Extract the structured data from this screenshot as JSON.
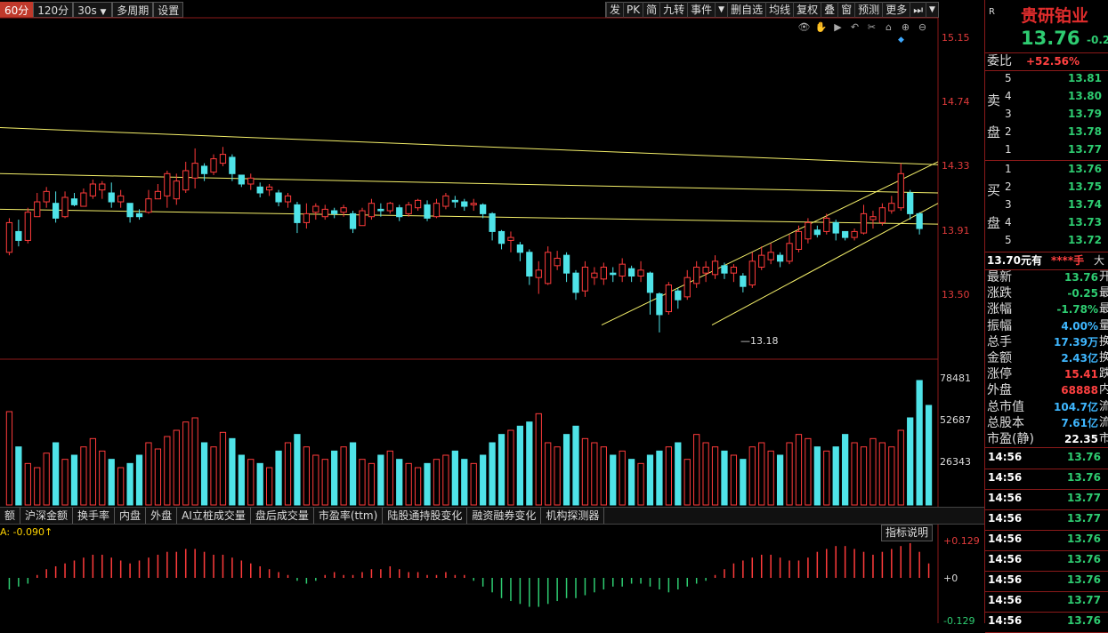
{
  "toolbar": {
    "left": [
      "60分",
      "120分",
      "30s",
      "多周期",
      "设置"
    ],
    "right": [
      "发",
      "PK",
      "简",
      "九转",
      "事件",
      "删自选",
      "均线",
      "复权",
      "叠",
      "窗",
      "预测",
      "更多"
    ]
  },
  "price_axis": [
    "15.15",
    "14.74",
    "14.33",
    "13.91",
    "13.50"
  ],
  "volume_axis": [
    "78481",
    "52687",
    "26343"
  ],
  "macd_axis": {
    "top": "+0.129",
    "mid": "+0",
    "bottom": "-0.129"
  },
  "low_label": "13.18",
  "macd_value": "A: -0.090↑",
  "indicator_tabs": [
    "额",
    "沪深金额",
    "换手率",
    "内盘",
    "外盘",
    "AI立桩成交量",
    "盘后成交量",
    "市盈率(ttm)",
    "陆股通持股变化",
    "融资融券变化",
    "机构探测器"
  ],
  "help_button": "指标说明",
  "quote": {
    "badge": "R",
    "name": "贵研铂业",
    "price": "13.76",
    "change": "-0.2",
    "weibi_label": "委比",
    "weibi_value": "+52.56%",
    "sell_label": [
      "卖",
      "盘"
    ],
    "buy_label": [
      "买",
      "盘"
    ],
    "sell": [
      [
        "5",
        "13.81"
      ],
      [
        "4",
        "13.80"
      ],
      [
        "3",
        "13.79"
      ],
      [
        "2",
        "13.78"
      ],
      [
        "1",
        "13.77"
      ]
    ],
    "buy": [
      [
        "1",
        "13.76"
      ],
      [
        "2",
        "13.75"
      ],
      [
        "3",
        "13.74"
      ],
      [
        "4",
        "13.73"
      ],
      [
        "5",
        "13.72"
      ]
    ],
    "bigorder_price": "13.70元有",
    "bigorder_mask": "****手",
    "bigorder_tail": "大",
    "stats": [
      {
        "label": "最新",
        "value": "13.76",
        "tail": "开",
        "color": "green"
      },
      {
        "label": "涨跌",
        "value": "-0.25",
        "tail": "最",
        "color": "green"
      },
      {
        "label": "涨幅",
        "value": "-1.78%",
        "tail": "最",
        "color": "green"
      },
      {
        "label": "振幅",
        "value": "4.00%",
        "tail": "量",
        "color": "cyan"
      },
      {
        "label": "总手",
        "value": "17.39万",
        "tail": "换",
        "color": "cyan"
      },
      {
        "label": "金额",
        "value": "2.43亿",
        "tail": "换",
        "color": "cyan"
      },
      {
        "label": "涨停",
        "value": "15.41",
        "tail": "跌",
        "color": "red"
      },
      {
        "label": "外盘",
        "value": "68888",
        "tail": "内",
        "color": "red"
      },
      {
        "label": "总市值",
        "value": "104.7亿",
        "tail": "流",
        "color": "cyan"
      },
      {
        "label": "总股本",
        "value": "7.61亿",
        "tail": "流",
        "color": "cyan"
      },
      {
        "label": "市盈(静)",
        "value": "22.35",
        "tail": "市",
        "color": "white"
      }
    ],
    "ticks": [
      {
        "time": "14:56",
        "price": "13.76"
      },
      {
        "time": "14:56",
        "price": "13.76"
      },
      {
        "time": "14:56",
        "price": "13.77"
      },
      {
        "time": "14:56",
        "price": "13.77"
      },
      {
        "time": "14:56",
        "price": "13.76"
      },
      {
        "time": "14:56",
        "price": "13.76"
      },
      {
        "time": "14:56",
        "price": "13.76"
      },
      {
        "time": "14:56",
        "price": "13.77"
      },
      {
        "time": "14:56",
        "price": "13.76"
      }
    ]
  },
  "colors": {
    "up": "#ff3b3b",
    "down": "#4fe3e8",
    "trend": "#f5f06a",
    "frame": "#8b1a1a"
  },
  "chart_data": {
    "type": "candlestick",
    "ylim": [
      13.0,
      15.3
    ],
    "candles": [
      [
        13.72,
        13.92,
        13.86,
        13.95,
        13.7
      ],
      [
        13.86,
        13.8,
        13.94,
        13.76,
        13.89
      ],
      [
        13.8,
        13.99,
        13.95,
        14.02,
        13.78
      ],
      [
        13.96,
        14.06,
        14.09,
        14.12,
        13.96
      ],
      [
        14.06,
        14.13,
        14.04,
        14.16,
        14.02
      ],
      [
        14.05,
        13.95,
        14.13,
        13.92,
        14.13
      ],
      [
        13.96,
        14.09,
        14.06,
        14.13,
        13.95
      ],
      [
        14.08,
        14.04,
        14.12,
        14.03,
        14.08
      ],
      [
        14.03,
        14.12,
        14.1,
        14.15,
        14.03
      ],
      [
        14.1,
        14.18,
        14.14,
        14.21,
        14.08
      ],
      [
        14.14,
        14.18,
        14.1,
        14.2,
        14.08
      ],
      [
        14.12,
        14.06,
        14.19,
        14.02,
        14.14
      ],
      [
        14.06,
        14.1,
        14.05,
        14.14,
        14.02
      ],
      [
        14.05,
        13.96,
        13.98,
        14.02,
        13.92
      ],
      [
        13.98,
        13.96,
        14.01,
        13.94,
        14.0
      ],
      [
        13.99,
        14.08,
        14.07,
        14.14,
        13.98
      ],
      [
        14.08,
        14.13,
        14.1,
        14.18,
        14.08
      ],
      [
        14.1,
        14.25,
        14.06,
        14.27,
        14.02
      ],
      [
        14.08,
        14.2,
        14.14,
        14.25,
        14.04
      ],
      [
        14.14,
        14.27,
        14.2,
        14.33,
        14.12
      ],
      [
        14.22,
        14.32,
        14.3,
        14.42,
        14.15
      ],
      [
        14.3,
        14.25,
        14.32,
        14.2,
        14.27
      ],
      [
        14.26,
        14.35,
        14.32,
        14.38,
        14.24
      ],
      [
        14.32,
        14.38,
        14.36,
        14.43,
        14.3
      ],
      [
        14.36,
        14.25,
        14.38,
        14.2,
        14.24
      ],
      [
        14.24,
        14.18,
        14.21,
        14.16,
        14.18
      ],
      [
        14.18,
        14.22,
        14.16,
        14.25,
        14.14
      ],
      [
        14.16,
        14.12,
        14.19,
        14.09,
        14.14
      ],
      [
        14.14,
        14.16,
        14.13,
        14.18,
        14.1
      ],
      [
        14.12,
        14.06,
        14.14,
        14.03,
        14.06
      ],
      [
        14.06,
        14.1,
        14.04,
        14.12,
        14.02
      ],
      [
        14.04,
        13.92,
        14.06,
        13.85,
        13.92
      ],
      [
        13.92,
        13.98,
        14.0,
        14.05,
        13.88
      ],
      [
        13.99,
        14.03,
        13.96,
        14.05,
        13.94
      ],
      [
        13.96,
        14.01,
        13.99,
        14.04,
        13.94
      ],
      [
        14.0,
        13.98,
        14.02,
        13.95,
        14.0
      ],
      [
        13.99,
        14.02,
        13.98,
        14.04,
        13.96
      ],
      [
        13.98,
        13.88,
        14.0,
        13.85,
        13.88
      ],
      [
        13.9,
        14.0,
        13.96,
        14.02,
        13.9
      ],
      [
        13.96,
        14.05,
        14.0,
        14.08,
        13.94
      ],
      [
        14.01,
        14.0,
        14.05,
        13.96,
        14.0
      ],
      [
        14.0,
        14.05,
        14.02,
        14.06,
        13.98
      ],
      [
        14.02,
        13.96,
        14.04,
        13.93,
        13.99
      ],
      [
        13.98,
        14.04,
        14.01,
        14.06,
        13.96
      ],
      [
        14.02,
        14.07,
        14.04,
        14.08,
        14.0
      ],
      [
        14.04,
        13.95,
        14.07,
        13.93,
        13.96
      ],
      [
        13.96,
        14.05,
        14.02,
        14.08,
        13.95
      ],
      [
        14.03,
        14.1,
        14.07,
        14.12,
        14.01
      ],
      [
        14.07,
        14.06,
        14.1,
        14.02,
        14.06
      ],
      [
        14.06,
        14.03,
        14.08,
        14.0,
        14.04
      ],
      [
        14.04,
        14.05,
        14.03,
        14.08,
        14.0
      ],
      [
        14.04,
        13.98,
        14.05,
        13.95,
        13.98
      ],
      [
        13.98,
        13.86,
        13.99,
        13.8,
        13.86
      ],
      [
        13.86,
        13.78,
        13.87,
        13.74,
        13.8
      ],
      [
        13.8,
        13.82,
        13.76,
        13.86,
        13.72
      ],
      [
        13.77,
        13.72,
        13.79,
        13.66,
        13.72
      ],
      [
        13.72,
        13.56,
        13.74,
        13.5,
        13.56
      ],
      [
        13.55,
        13.6,
        13.5,
        13.66,
        13.44
      ],
      [
        13.51,
        13.72,
        13.62,
        13.76,
        13.5
      ],
      [
        13.63,
        13.68,
        13.7,
        13.73,
        13.6
      ],
      [
        13.7,
        13.58,
        13.72,
        13.52,
        13.6
      ],
      [
        13.58,
        13.45,
        13.6,
        13.4,
        13.46
      ],
      [
        13.46,
        13.62,
        13.55,
        13.66,
        13.42
      ],
      [
        13.55,
        13.58,
        13.54,
        13.62,
        13.5
      ],
      [
        13.54,
        13.62,
        13.58,
        13.65,
        13.5
      ],
      [
        13.58,
        13.57,
        13.62,
        13.52,
        13.56
      ],
      [
        13.56,
        13.64,
        13.6,
        13.68,
        13.52
      ],
      [
        13.61,
        13.56,
        13.63,
        13.52,
        13.56
      ],
      [
        13.56,
        13.6,
        13.58,
        13.66,
        13.52
      ],
      [
        13.58,
        13.45,
        13.59,
        13.3,
        13.44
      ],
      [
        13.44,
        13.3,
        13.45,
        13.18,
        13.3
      ],
      [
        13.32,
        13.5,
        13.45,
        13.52,
        13.3
      ],
      [
        13.46,
        13.4,
        13.48,
        13.34,
        13.42
      ],
      [
        13.42,
        13.55,
        13.5,
        13.6,
        13.4
      ],
      [
        13.51,
        13.62,
        13.57,
        13.66,
        13.48
      ],
      [
        13.58,
        13.62,
        13.56,
        13.66,
        13.52
      ],
      [
        13.57,
        13.66,
        13.62,
        13.7,
        13.54
      ],
      [
        13.63,
        13.58,
        13.65,
        13.54,
        13.58
      ],
      [
        13.58,
        13.62,
        13.56,
        13.64,
        13.52
      ],
      [
        13.56,
        13.49,
        13.58,
        13.45,
        13.5
      ],
      [
        13.5,
        13.66,
        13.62,
        13.72,
        13.48
      ],
      [
        13.62,
        13.7,
        13.66,
        13.76,
        13.6
      ],
      [
        13.67,
        13.72,
        13.7,
        13.78,
        13.64
      ],
      [
        13.7,
        13.66,
        13.72,
        13.62,
        13.66
      ],
      [
        13.66,
        13.78,
        13.74,
        13.84,
        13.64
      ],
      [
        13.74,
        13.86,
        13.8,
        13.9,
        13.72
      ],
      [
        13.81,
        13.92,
        13.86,
        13.95,
        13.78
      ],
      [
        13.87,
        13.84,
        13.9,
        13.82,
        13.86
      ],
      [
        13.86,
        13.95,
        13.92,
        13.98,
        13.84
      ],
      [
        13.92,
        13.85,
        13.94,
        13.8,
        13.85
      ],
      [
        13.86,
        13.82,
        13.84,
        13.8,
        13.82
      ],
      [
        13.82,
        13.86,
        13.84,
        13.88,
        13.8
      ],
      [
        13.85,
        13.98,
        13.94,
        14.04,
        13.84
      ],
      [
        13.94,
        13.96,
        13.9,
        14.0,
        13.88
      ],
      [
        13.92,
        14.02,
        13.98,
        14.05,
        13.9
      ],
      [
        14.0,
        14.05,
        14.02,
        14.1,
        13.98
      ],
      [
        14.02,
        14.25,
        14.1,
        14.32,
        14.0
      ],
      [
        14.12,
        13.98,
        14.14,
        13.94,
        13.98
      ],
      [
        13.98,
        13.88,
        13.99,
        13.84,
        13.86
      ]
    ],
    "price_lines": [
      {
        "label": "upper resistance",
        "from": 14.56,
        "to": 14.31
      },
      {
        "label": "mid resistance",
        "from": 14.25,
        "to": 14.12
      },
      {
        "label": "lower resistance",
        "from": 14.01,
        "to": 13.91
      },
      {
        "label": "channel upper",
        "from": 13.23,
        "to": 14.33
      },
      {
        "label": "channel lower",
        "from": 13.23,
        "to": 14.05
      }
    ],
    "volume": [
      45,
      28,
      20,
      18,
      25,
      30,
      22,
      24,
      28,
      32,
      26,
      22,
      18,
      20,
      24,
      30,
      27,
      33,
      36,
      40,
      42,
      30,
      28,
      35,
      32,
      24,
      22,
      20,
      18,
      26,
      30,
      34,
      28,
      24,
      22,
      26,
      28,
      30,
      22,
      20,
      24,
      26,
      22,
      20,
      18,
      20,
      22,
      24,
      26,
      22,
      20,
      24,
      30,
      34,
      36,
      38,
      40,
      44,
      30,
      28,
      34,
      38,
      32,
      30,
      28,
      24,
      26,
      22,
      20,
      24,
      26,
      28,
      30,
      22,
      34,
      30,
      28,
      26,
      24,
      22,
      28,
      30,
      26,
      24,
      30,
      34,
      32,
      28,
      26,
      28,
      34,
      30,
      28,
      32,
      30,
      28,
      36,
      42,
      60,
      48
    ],
    "macd_hist": [
      -0.04,
      -0.03,
      -0.02,
      0.01,
      0.03,
      0.04,
      0.05,
      0.06,
      0.07,
      0.08,
      0.08,
      0.07,
      0.06,
      0.05,
      0.06,
      0.07,
      0.08,
      0.09,
      0.09,
      0.1,
      0.1,
      0.09,
      0.08,
      0.08,
      0.07,
      0.06,
      0.05,
      0.04,
      0.03,
      0.02,
      0.01,
      -0.01,
      -0.02,
      -0.01,
      0.01,
      0.02,
      0.01,
      0.01,
      0.02,
      0.03,
      0.03,
      0.04,
      0.03,
      0.02,
      0.02,
      0.01,
      0.01,
      0.02,
      0.01,
      0.01,
      -0.01,
      -0.03,
      -0.05,
      -0.07,
      -0.08,
      -0.09,
      -0.1,
      -0.1,
      -0.09,
      -0.08,
      -0.07,
      -0.07,
      -0.06,
      -0.05,
      -0.04,
      -0.03,
      -0.03,
      -0.02,
      -0.02,
      -0.03,
      -0.04,
      -0.05,
      -0.04,
      -0.03,
      -0.02,
      -0.01,
      0.01,
      0.03,
      0.05,
      0.06,
      0.07,
      0.08,
      0.08,
      0.07,
      0.06,
      0.06,
      0.07,
      0.09,
      0.1,
      0.11,
      0.11,
      0.1,
      0.09,
      0.08,
      0.09,
      0.1,
      0.11,
      0.12,
      0.09,
      0.05
    ]
  }
}
